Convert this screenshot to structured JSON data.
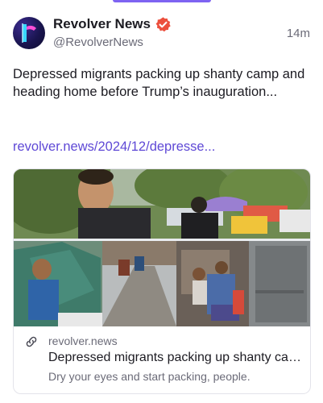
{
  "post": {
    "author_name": "Revolver News",
    "handle": "@RevolverNews",
    "timestamp": "14m",
    "text": "Depressed migrants packing up shanty camp and heading home before Trump’s inauguration...",
    "link": "revolver.news/2024/12/depresse..."
  },
  "card": {
    "domain": "revolver.news",
    "title": "Depressed migrants packing up shanty camp and heading home before Trump’s inauguration",
    "description": "Dry your eyes and start packing, people."
  },
  "colors": {
    "accent": "#7e63f2",
    "link": "#5f49d6",
    "verified": "#ec4f3d",
    "muted_text": "#6b6b78"
  },
  "icons": {
    "avatar": "revolver-r-logo",
    "verified": "verified-badge-icon",
    "link": "link-icon"
  }
}
